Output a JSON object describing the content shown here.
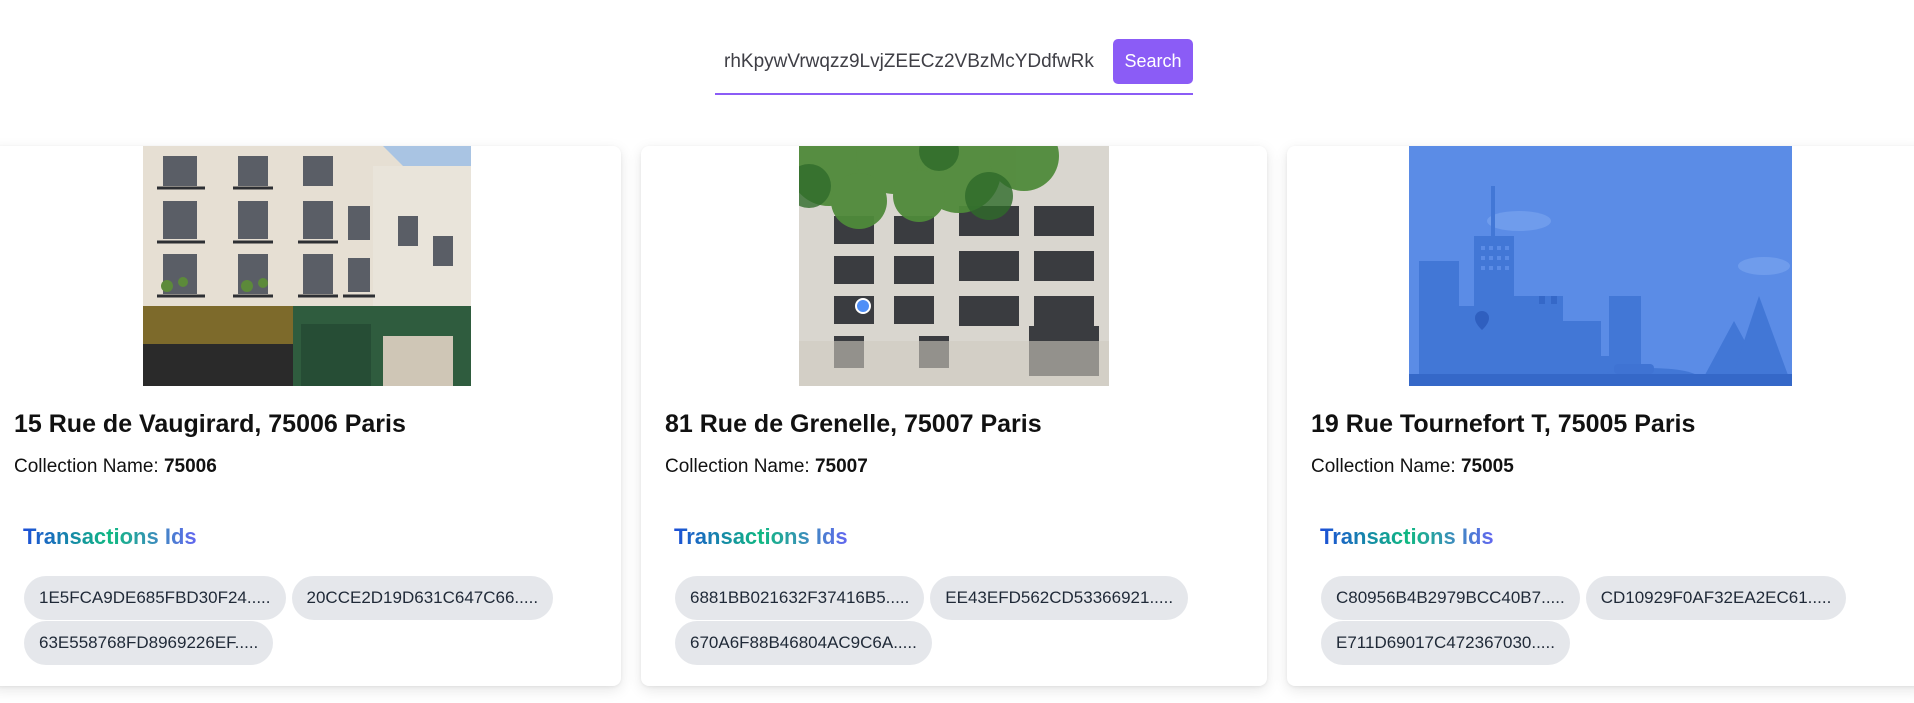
{
  "search": {
    "value": "rhKpywVrwqzz9LvjZEECz2VBzMcYDdfwRk",
    "button_label": "Search",
    "accent_color": "#8b5cf6"
  },
  "cards": [
    {
      "image_icon": "building-photo",
      "title": "15 Rue de Vaugirard, 75006 Paris",
      "collection_label": "Collection Name: ",
      "collection_value": "75006",
      "transactions_heading": "Transactions Ids",
      "transactions": [
        "1E5FCA9DE685FBD30F24.....",
        "20CCE2D19D631C647C66.....",
        "63E558768FD8969226EF....."
      ]
    },
    {
      "image_icon": "building-photo",
      "title": "81 Rue de Grenelle, 75007 Paris",
      "collection_label": "Collection Name: ",
      "collection_value": "75007",
      "transactions_heading": "Transactions Ids",
      "transactions": [
        "6881BB021632F37416B5.....",
        "EE43EFD562CD53366921.....",
        "670A6F88B46804AC9C6A....."
      ]
    },
    {
      "image_icon": "city-illustration",
      "title": "19 Rue Tournefort T, 75005 Paris",
      "collection_label": "Collection Name: ",
      "collection_value": "75005",
      "transactions_heading": "Transactions Ids",
      "transactions": [
        "C80956B4B2979BCC40B7.....",
        "CD10929F0AF32EA2EC61.....",
        "E711D69017C472367030....."
      ]
    }
  ]
}
